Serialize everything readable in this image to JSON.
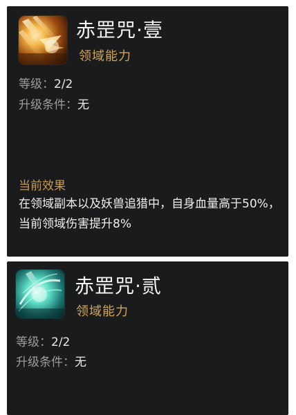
{
  "cards": [
    {
      "icon": "golden-strike-icon",
      "title": "赤罡咒·壹",
      "subtitle": "领域能力",
      "level_label": "等级：",
      "level_value": "2/2",
      "upgrade_label": "升级条件：",
      "upgrade_value": "无",
      "effect_label": "当前效果",
      "effect_text": "在领域副本以及妖兽追猎中，自身血量高于50%，当前领域伤害提升8%"
    },
    {
      "icon": "cyan-slash-icon",
      "title": "赤罡咒·贰",
      "subtitle": "领域能力",
      "level_label": "等级：",
      "level_value": "2/2",
      "upgrade_label": "升级条件：",
      "upgrade_value": "无"
    }
  ],
  "colors": {
    "card_bg": "#1a1b1d",
    "title": "#f4f4f2",
    "subtitle_gold": "#d2a659",
    "label_gray": "#9d9d9a",
    "value": "#e8e8e6",
    "effect_label": "#c89a52"
  }
}
